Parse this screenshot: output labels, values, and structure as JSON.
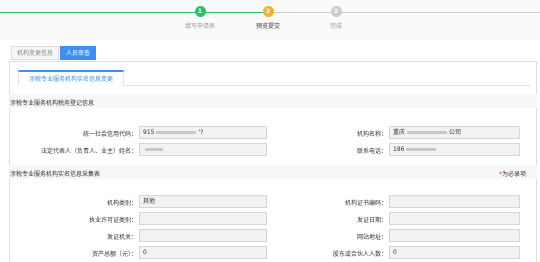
{
  "steps": [
    {
      "number": "1",
      "label": "填写申请表",
      "color": "#2fc069"
    },
    {
      "number": "2",
      "label": "预览提交",
      "color": "#f0b323"
    },
    {
      "number": "3",
      "label": "完成",
      "color": "#cccccc"
    }
  ],
  "tabs": {
    "org_change": "机构变更信息",
    "personnel_change": "人员审查"
  },
  "subtab": "涉税专业服务机构实名信息变更",
  "section1": {
    "title": "涉税专业服务机构税务登记信息",
    "credit_code_label": "统一社会信用代码：",
    "credit_code_value": "915",
    "credit_code_tail": "'?",
    "org_name_label": "机构名称：",
    "org_name_value": "重庆",
    "org_name_tail": "公司",
    "legal_rep_label": "法定代表人（负责人、业主）姓名：",
    "legal_rep_value": "",
    "phone_label": "联系电话：",
    "phone_value": "186"
  },
  "section2": {
    "title": "涉税专业服务机构实名信息采集表",
    "required_star": "*",
    "required_note": "为必录项",
    "org_type_label": "机构类别：",
    "org_type_value": "其他",
    "org_cert_label": "机构证书编码：",
    "org_cert_value": "",
    "license_type_label": "执业许可证类别：",
    "license_type_value": "",
    "issue_date_label": "发证日期：",
    "issue_date_value": "",
    "issuer_label": "发证机关：",
    "issuer_value": "",
    "website_label": "网站地址：",
    "website_value": "",
    "total_assets_label": "资产总额（元）：",
    "total_assets_value": "0",
    "partners_label": "股东或合伙人人数：",
    "partners_value": "0"
  }
}
